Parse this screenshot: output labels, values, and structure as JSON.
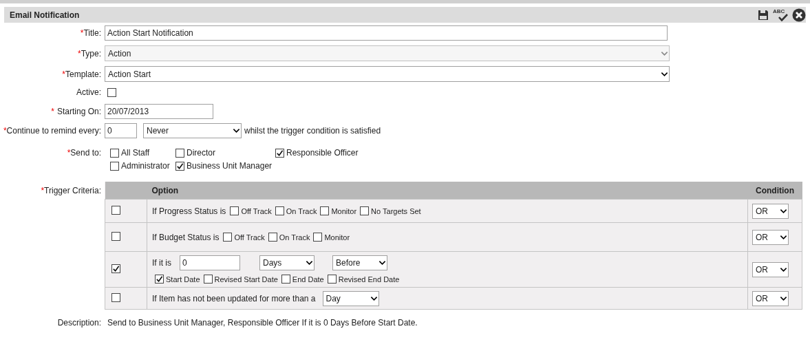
{
  "header": {
    "title": "Email Notification",
    "tools": [
      {
        "kind": "save"
      },
      {
        "kind": "spellcheck",
        "text": "ABC"
      },
      {
        "kind": "close"
      }
    ]
  },
  "fields": [
    {
      "kind": "text",
      "mark": "*",
      "label": "Title:",
      "value": "Action Start Notification"
    },
    {
      "kind": "select",
      "mark": "*",
      "label": "Type:",
      "value": "Action",
      "disabled": true
    },
    {
      "kind": "select",
      "mark": "*",
      "label": "Template:",
      "value": "Action Start",
      "disabled": false
    },
    {
      "kind": "checkbox",
      "label": "Active:",
      "checked": false
    },
    {
      "kind": "date",
      "mark": "*",
      "label": "Starting On:",
      "value": "20/07/2013"
    },
    {
      "kind": "remind",
      "mark": "*",
      "label": "Continue to remind every:",
      "value": "0",
      "unit": "Never",
      "suffix": "whilst the trigger condition is satisfied"
    }
  ],
  "send_to": {
    "mark": "*",
    "label": "Send to:",
    "options": [
      {
        "label": "All Staff",
        "checked": false
      },
      {
        "label": "Director",
        "checked": false
      },
      {
        "label": "Responsible Officer",
        "checked": true
      },
      {
        "label": "Administrator",
        "checked": false
      },
      {
        "label": "Business Unit Manager",
        "checked": true
      }
    ]
  },
  "trigger": {
    "mark": "*",
    "label": "Trigger Criteria:",
    "columns": [
      "Option",
      "Condition"
    ],
    "rows": [
      {
        "kind": "status",
        "checked": false,
        "text": "If Progress Status is",
        "options": [
          {
            "label": "Off Track",
            "checked": false
          },
          {
            "label": "On Track",
            "checked": false
          },
          {
            "label": "Monitor",
            "checked": false
          },
          {
            "label": "No Targets Set",
            "checked": false
          }
        ],
        "condition": "OR"
      },
      {
        "kind": "status",
        "checked": false,
        "text": "If Budget Status is",
        "options": [
          {
            "label": "Off Track",
            "checked": false
          },
          {
            "label": "On Track",
            "checked": false
          },
          {
            "label": "Monitor",
            "checked": false
          }
        ],
        "condition": "OR"
      },
      {
        "kind": "date",
        "checked": true,
        "text": "If it is",
        "value": "0",
        "unit": "Days",
        "direction": "Before",
        "options": [
          {
            "label": "Start Date",
            "checked": true
          },
          {
            "label": "Revised Start Date",
            "checked": false
          },
          {
            "label": "End Date",
            "checked": false
          },
          {
            "label": "Revised End Date",
            "checked": false
          }
        ],
        "condition": "OR"
      },
      {
        "kind": "stale",
        "checked": false,
        "text": "If Item has not been updated for more than a",
        "unit": "Day",
        "condition": "OR"
      }
    ]
  },
  "description": {
    "label": "Description:",
    "text": "Send to Business Unit Manager, Responsible Officer If it is 0 Days Before Start Date."
  }
}
